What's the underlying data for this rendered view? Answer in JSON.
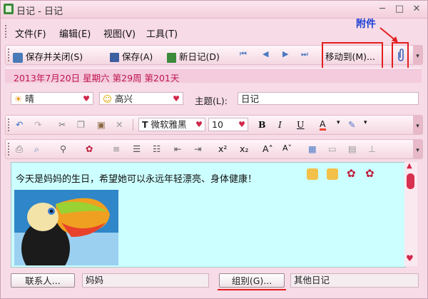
{
  "window": {
    "title": "日记 - 日记"
  },
  "menu": {
    "items": [
      "文件(F)",
      "编辑(E)",
      "视图(V)",
      "工具(T)"
    ]
  },
  "toolbar": {
    "save_close": "保存并关闭(S)",
    "save": "保存(A)",
    "new_diary": "新日记(D)",
    "move_to": "移动到(M)..."
  },
  "annotation": {
    "attachment": "附件"
  },
  "date_line": "2013年7月20日 星期六  第29周 第201天",
  "entry": {
    "weather": "晴",
    "mood": "高兴",
    "subject_label": "主题(L):",
    "subject_value": "日记"
  },
  "format": {
    "font": "微软雅黑",
    "size": "10"
  },
  "body": {
    "text": "今天是妈妈的生日，希望她可以永远年轻漂亮、身体健康！"
  },
  "footer": {
    "contacts_button": "联系人...",
    "contact_value": "妈妈",
    "group_button": "组别(G)...",
    "group_value": "其他日记"
  },
  "colors": {
    "accent_red": "#e21f1f",
    "date_text": "#c0144e",
    "content_bg": "#ccffff"
  }
}
